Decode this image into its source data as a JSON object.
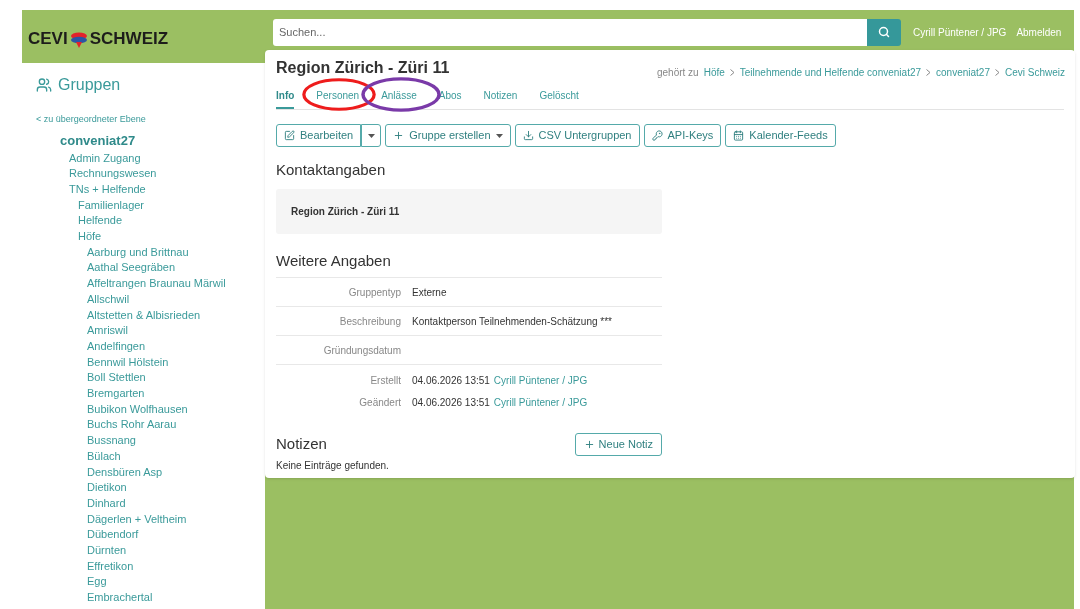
{
  "header": {
    "logo_left": "CEVI",
    "logo_right": "SCHWEIZ",
    "search": {
      "placeholder": "Suchen..."
    },
    "user": "Cyrill Püntener / JPG",
    "logout": "Abmelden"
  },
  "sidebar": {
    "title": "Gruppen",
    "back_link": "< zu übergeordneter Ebene",
    "tree": [
      {
        "label": "conveniat27",
        "children": [
          {
            "label": "Admin Zugang"
          },
          {
            "label": "Rechnungswesen"
          },
          {
            "label": "TNs + Helfende",
            "children": [
              {
                "label": "Familienlager"
              },
              {
                "label": "Helfende"
              },
              {
                "label": "Höfe",
                "children": [
                  {
                    "label": "Aarburg und Brittnau"
                  },
                  {
                    "label": "Aathal Seegräben"
                  },
                  {
                    "label": "Affeltrangen Braunau Märwil"
                  },
                  {
                    "label": "Allschwil"
                  },
                  {
                    "label": "Altstetten & Albisrieden"
                  },
                  {
                    "label": "Amriswil"
                  },
                  {
                    "label": "Andelfingen"
                  },
                  {
                    "label": "Bennwil Hölstein"
                  },
                  {
                    "label": "Boll Stettlen"
                  },
                  {
                    "label": "Bremgarten"
                  },
                  {
                    "label": "Bubikon Wolfhausen"
                  },
                  {
                    "label": "Buchs Rohr Aarau"
                  },
                  {
                    "label": "Bussnang"
                  },
                  {
                    "label": "Bülach"
                  },
                  {
                    "label": "Densbüren Asp"
                  },
                  {
                    "label": "Dietikon"
                  },
                  {
                    "label": "Dinhard"
                  },
                  {
                    "label": "Dägerlen + Veltheim"
                  },
                  {
                    "label": "Dübendorf"
                  },
                  {
                    "label": "Dürnten"
                  },
                  {
                    "label": "Effretikon"
                  },
                  {
                    "label": "Egg"
                  },
                  {
                    "label": "Embrachertal"
                  }
                ]
              }
            ]
          }
        ]
      }
    ]
  },
  "main": {
    "title": "Region Zürich - Züri 11",
    "belongs_to_label": "gehört zu",
    "breadcrumbs": [
      "Höfe",
      "Teilnehmende und Helfende conveniat27",
      "conveniat27",
      "Cevi Schweiz"
    ],
    "tabs": [
      {
        "label": "Info",
        "selected": true
      },
      {
        "label": "Personen",
        "selected": false
      },
      {
        "label": "Anlässe",
        "selected": false
      },
      {
        "label": "Abos",
        "selected": false
      },
      {
        "label": "Notizen",
        "selected": false
      },
      {
        "label": "Gelöscht",
        "selected": false
      }
    ],
    "buttons": [
      {
        "kind": "edit",
        "label": "Bearbeiten"
      },
      {
        "kind": "caret"
      },
      {
        "kind": "create",
        "label": "Gruppe erstellen"
      },
      {
        "kind": "download",
        "label": "CSV Untergruppen"
      },
      {
        "kind": "key",
        "label": "API-Keys"
      },
      {
        "kind": "calendar",
        "label": "Kalender-Feeds"
      }
    ],
    "contact_heading": "Kontaktangaben",
    "contact_name": "Region Zürich - Züri 11",
    "details_heading": "Weitere Angaben",
    "details": [
      {
        "label": "Gruppentyp",
        "value": "Externe"
      },
      {
        "label": "Beschreibung",
        "value": "Kontaktperson Teilnehmenden-Schätzung ***"
      },
      {
        "label": "Gründungsdatum"
      }
    ],
    "history": [
      {
        "label": "Erstellt",
        "value": "04.06.2026 13:51",
        "link": "Cyrill Püntener / JPG"
      },
      {
        "label": "Geändert",
        "value": "04.06.2026 13:51",
        "link": "Cyrill Püntener / JPG"
      }
    ],
    "notes_heading": "Notizen",
    "new_note": "Neue Notiz",
    "notes_empty": "Keine Einträge gefunden.",
    "annotations": [
      {
        "color": "#ee1c1c"
      },
      {
        "color": "#7a3aa8"
      }
    ]
  }
}
